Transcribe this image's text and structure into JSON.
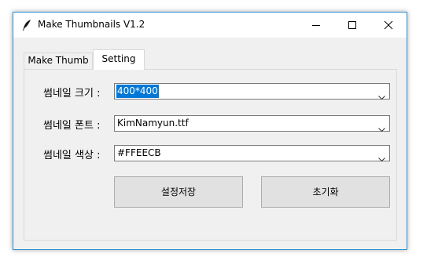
{
  "window": {
    "title": "Make Thumbnails V1.2"
  },
  "tabs": [
    {
      "label": "Make Thumb",
      "active": false
    },
    {
      "label": "Setting",
      "active": true
    }
  ],
  "settings": {
    "size": {
      "label": "썸네일 크기 :",
      "value": "400*400"
    },
    "font": {
      "label": "썸네일 폰트 :",
      "value": "KimNamyun.ttf"
    },
    "color": {
      "label": "썸네일 색상 :",
      "value": "#FFEECB"
    }
  },
  "buttons": {
    "save_label": "설정저장",
    "reset_label": "초기화"
  },
  "colors": {
    "selection": "#0078d7",
    "window_border": "#2d8fd5"
  },
  "icons": {
    "app": "feather-icon",
    "minimize": "minimize-icon",
    "maximize": "maximize-icon",
    "close": "close-icon",
    "dropdown": "chevron-down-icon"
  }
}
